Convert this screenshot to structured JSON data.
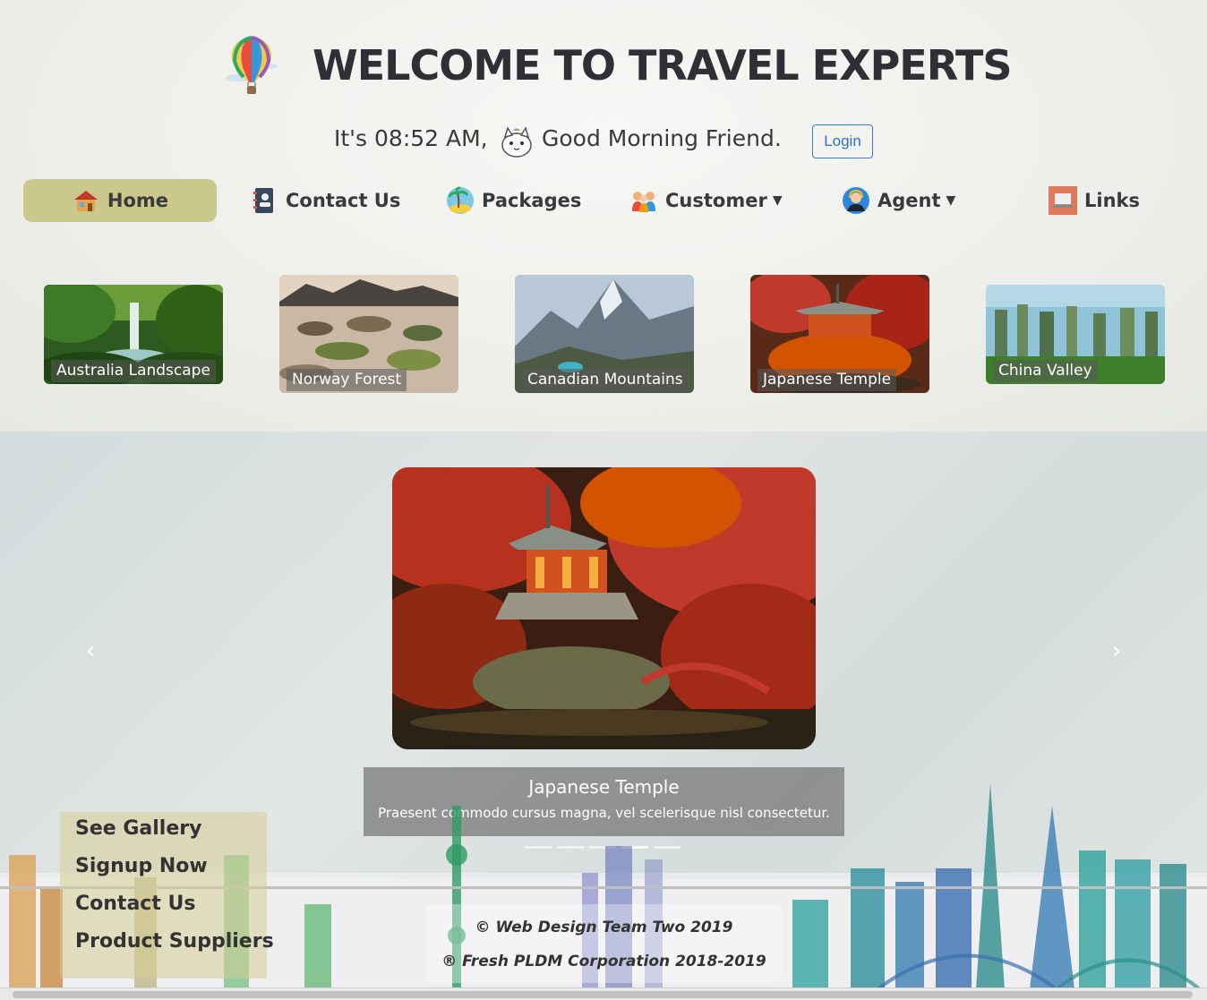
{
  "header": {
    "title": "WELCOME TO TRAVEL EXPERTS",
    "logo_icon": "hot-air-balloon-icon"
  },
  "greeting": {
    "time_text": "It's 08:52 AM,",
    "message": "Good Morning Friend.",
    "avatar_icon": "cat-icon",
    "login_label": "Login"
  },
  "nav": {
    "items": [
      {
        "label": "Home",
        "icon": "house-icon",
        "active": true
      },
      {
        "label": "Contact Us",
        "icon": "address-book-icon"
      },
      {
        "label": "Packages",
        "icon": "island-icon"
      },
      {
        "label": "Customer",
        "icon": "people-icon",
        "dropdown": true
      },
      {
        "label": "Agent",
        "icon": "agent-icon",
        "dropdown": true
      },
      {
        "label": "Links",
        "icon": "laptop-icon"
      }
    ]
  },
  "thumbnails": [
    {
      "caption": "Australia Landscape"
    },
    {
      "caption": "Norway Forest"
    },
    {
      "caption": "Canadian Mountains"
    },
    {
      "caption": "Japanese Temple"
    },
    {
      "caption": "China Valley"
    }
  ],
  "carousel": {
    "title": "Japanese Temple",
    "text": "Praesent commodo cursus magna, vel scelerisque nisl consectetur.",
    "prev_icon": "chevron-left-icon",
    "next_icon": "chevron-right-icon",
    "slide_count": 5,
    "active_index": 3
  },
  "footer": {
    "links": [
      "See Gallery",
      "Signup Now",
      "Contact Us",
      "Product Suppliers"
    ],
    "copyright": "© Web Design Team Two 2019",
    "corporation": "® Fresh PLDM Corporation 2018-2019"
  },
  "colors": {
    "title": "#2f2f36",
    "active_nav": "#cbc88c",
    "login_border": "#3a7bd5"
  }
}
